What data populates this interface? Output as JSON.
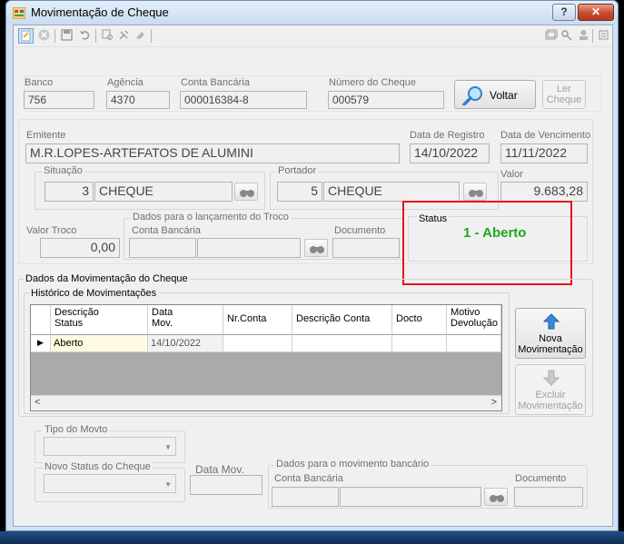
{
  "window": {
    "title": "Movimentação de Cheque",
    "help_label": "?",
    "close_label": "✕"
  },
  "toolbar": {
    "left_icons": [
      "new-icon",
      "cancel-icon",
      "save-icon",
      "undo-icon",
      "search-icon",
      "tools-icon",
      "clear-icon"
    ],
    "right_icons": [
      "window-icon",
      "key-icon",
      "user-icon",
      "menu-icon"
    ]
  },
  "bank": {
    "banco_label": "Banco",
    "banco_value": "756",
    "agencia_label": "Agência",
    "agencia_value": "4370",
    "conta_label": "Conta Bancária",
    "conta_value": "000016384-8",
    "numero_label": "Número do Cheque",
    "numero_value": "000579",
    "voltar_label": "Voltar",
    "ler_cheque_line1": "Ler",
    "ler_cheque_line2": "Cheque"
  },
  "cheque": {
    "emitente_label": "Emitente",
    "emitente_value": "M.R.LOPES-ARTEFATOS DE ALUMINI",
    "data_registro_label": "Data de Registro",
    "data_registro_value": "14/10/2022",
    "data_vencimento_label": "Data de Vencimento",
    "data_vencimento_value": "11/11/2022",
    "situacao_label": "Situação",
    "situacao_code": "3",
    "situacao_value": "CHEQUE",
    "portador_label": "Portador",
    "portador_code": "5",
    "portador_value": "CHEQUE",
    "valor_label": "Valor",
    "valor_value": "9.683,28",
    "valor_troco_label": "Valor Troco",
    "valor_troco_value": "0,00",
    "troco_group_label": "Dados para o lançamento do Troco",
    "troco_conta_label": "Conta Bancária",
    "troco_documento_label": "Documento",
    "status_label": "Status",
    "status_value": "1 - Aberto"
  },
  "movimentacao": {
    "group_label": "Dados da Movimentação do Cheque",
    "historico_label": "Histórico de Movimentações",
    "columns": [
      {
        "line1": "Descrição",
        "line2": "Status"
      },
      {
        "line1": "Data",
        "line2": "Mov."
      },
      {
        "line1": "Nr.Conta",
        "line2": ""
      },
      {
        "line1": "Descrição Conta",
        "line2": ""
      },
      {
        "line1": "Docto",
        "line2": ""
      },
      {
        "line1": "Motivo",
        "line2": "Devolução"
      }
    ],
    "rows": [
      {
        "indicator": "▶",
        "status": "Aberto",
        "data": "14/10/2022",
        "nr_conta": "",
        "descricao_conta": "",
        "docto": "",
        "motivo": ""
      }
    ],
    "nova_line1": "Nova",
    "nova_line2": "Movimentação",
    "excluir_line1": "Excluir",
    "excluir_line2": "Movimentação"
  },
  "novo": {
    "tipo_label": "Tipo do Movto",
    "novo_status_label": "Novo Status do Cheque",
    "data_mov_label": "Data Mov.",
    "banco_group_label": "Dados para o movimento bancário",
    "conta_label": "Conta Bancária",
    "documento_label": "Documento"
  },
  "colors": {
    "status_text": "#1fa51f",
    "highlight_border": "#e4141c",
    "window_frame": "#cfe1f3",
    "close_button": "#c74a2f",
    "accent_blue": "#2f7fd0"
  }
}
